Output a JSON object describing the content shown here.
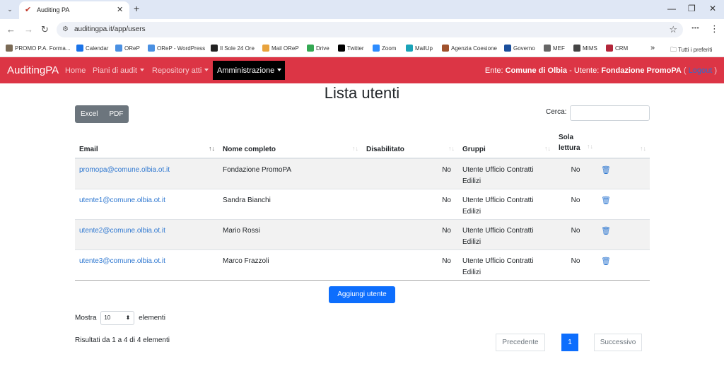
{
  "browser": {
    "tab_title": "Auditing PA",
    "url": "auditingpa.it/app/users",
    "bookmarks": [
      {
        "label": "PROMO P.A. Forma...",
        "color": "#7a6a55"
      },
      {
        "label": "Calendar",
        "color": "#1a73e8"
      },
      {
        "label": "OReP",
        "color": "#4a90e2"
      },
      {
        "label": "OReP - WordPress",
        "color": "#4a90e2"
      },
      {
        "label": "Il Sole 24 Ore",
        "color": "#222222"
      },
      {
        "label": "Mail OReP",
        "color": "#e8a33d"
      },
      {
        "label": "Drive",
        "color": "#34a853"
      },
      {
        "label": "Twitter",
        "color": "#000000"
      },
      {
        "label": "Zoom",
        "color": "#2d8cff"
      },
      {
        "label": "MailUp",
        "color": "#1aa3b8"
      },
      {
        "label": "Agenzia Coesione",
        "color": "#a0522d"
      },
      {
        "label": "Governo",
        "color": "#1b4f9c"
      },
      {
        "label": "MEF",
        "color": "#666666"
      },
      {
        "label": "MIMS",
        "color": "#444444"
      },
      {
        "label": "CRM",
        "color": "#b3263a"
      }
    ],
    "more_bookmarks": "»",
    "all_bookmarks": "Tutti i preferiti"
  },
  "navbar": {
    "brand": "AuditingPA",
    "links": [
      {
        "label": "Home",
        "dropdown": false
      },
      {
        "label": "Piani di audit",
        "dropdown": true
      },
      {
        "label": "Repository atti",
        "dropdown": true
      },
      {
        "label": "Amministrazione",
        "dropdown": true
      }
    ],
    "ente_label": "Ente:",
    "ente_value": "Comune di Olbia",
    "utente_label": "- Utente:",
    "utente_value": "Fondazione PromoPA",
    "open_paren": "(",
    "logout": "Logout",
    "close_paren": ")"
  },
  "page": {
    "title": "Lista utenti",
    "export_buttons": [
      "Excel",
      "PDF"
    ],
    "search_label": "Cerca:",
    "search_value": "",
    "add_button": "Aggiungi utente",
    "show_label": "Mostra",
    "show_value": "10",
    "show_suffix": "elementi",
    "results_text": "Risultati da 1 a 4 di 4 elementi",
    "pagination": {
      "prev": "Precedente",
      "current": "1",
      "next": "Successivo"
    }
  },
  "table": {
    "columns": [
      "Email",
      "Nome completo",
      "Disabilitato",
      "Gruppi",
      "Sola lettura",
      ""
    ],
    "rows": [
      {
        "email": "promopa@comune.olbia.ot.it",
        "name": "Fondazione PromoPA",
        "disabled": "No",
        "groups": "Utente Ufficio Contratti Edilizi",
        "readonly": "No"
      },
      {
        "email": "utente1@comune.olbia.ot.it",
        "name": "Sandra Bianchi",
        "disabled": "No",
        "groups": "Utente Ufficio Contratti Edilizi",
        "readonly": "No"
      },
      {
        "email": "utente2@comune.olbia.ot.it",
        "name": "Mario Rossi",
        "disabled": "No",
        "groups": "Utente Ufficio Contratti Edilizi",
        "readonly": "No"
      },
      {
        "email": "utente3@comune.olbia.ot.it",
        "name": "Marco Frazzoli",
        "disabled": "No",
        "groups": "Utente Ufficio Contratti Edilizi",
        "readonly": "No"
      }
    ]
  },
  "colors": {
    "navbar": "#dc3545",
    "primary": "#0d6efd",
    "link": "#2f78d1"
  }
}
